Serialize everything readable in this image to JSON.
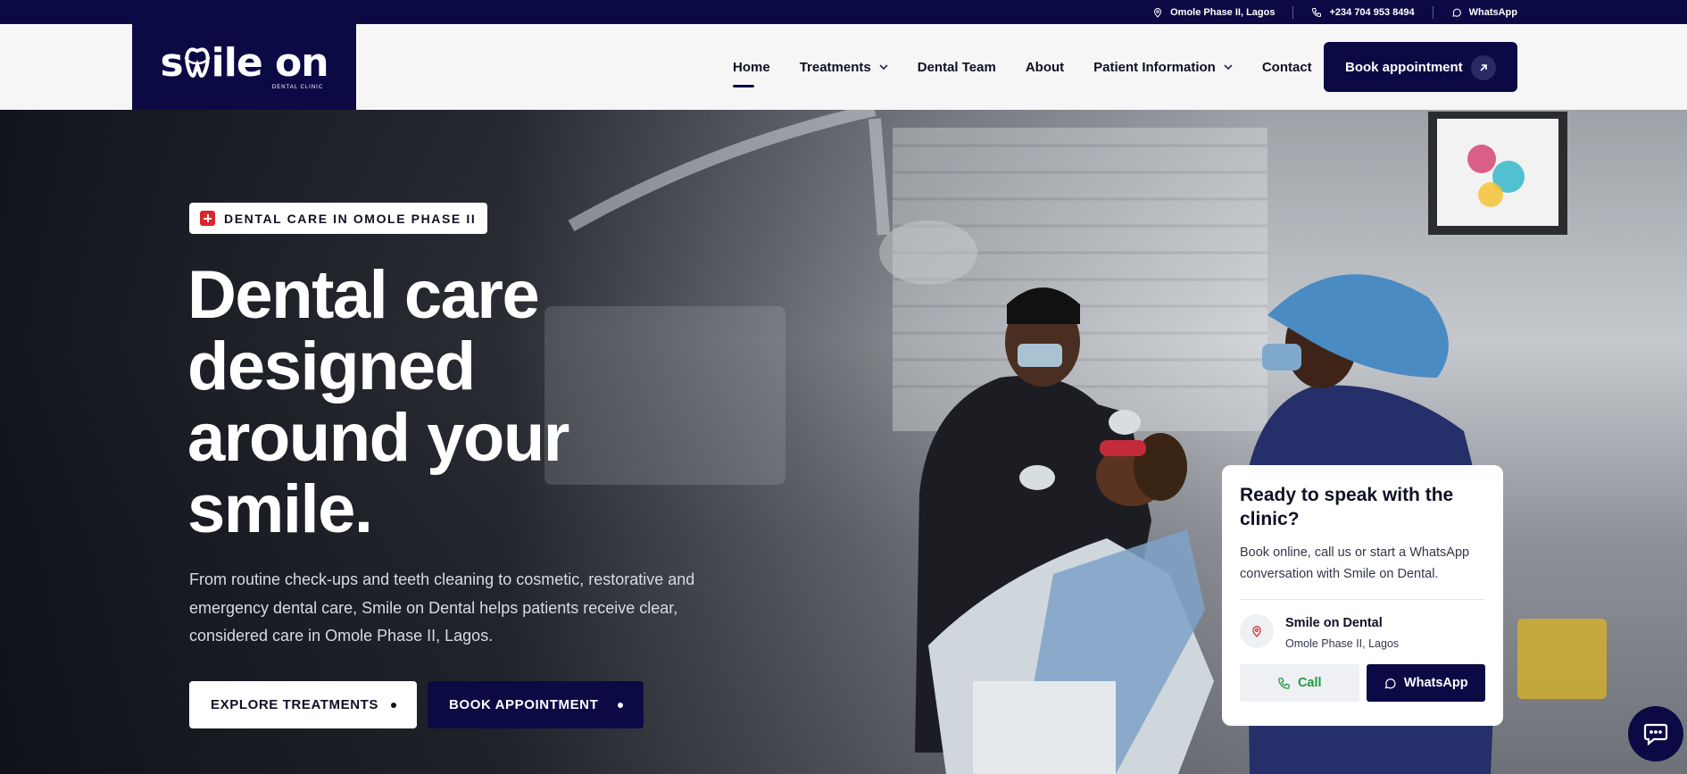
{
  "topbar": {
    "location": "Omole Phase II, Lagos",
    "phone": "+234 704 953 8494",
    "whatsapp": "WhatsApp"
  },
  "logo": {
    "word_start": "s",
    "word_end": "ile on",
    "subtitle": "DENTAL CLINIC"
  },
  "nav": {
    "items": [
      {
        "label": "Home",
        "active": true
      },
      {
        "label": "Treatments",
        "dropdown": true
      },
      {
        "label": "Dental Team"
      },
      {
        "label": "About"
      },
      {
        "label": "Patient Information",
        "dropdown": true
      },
      {
        "label": "Contact"
      }
    ],
    "book_label": "Book appointment"
  },
  "hero": {
    "badge": "DENTAL CARE IN OMOLE PHASE II",
    "headline": [
      "Dental care",
      "designed",
      "around your",
      "smile."
    ],
    "lede": "From routine check-ups and teeth cleaning to cosmetic, restorative and emergency dental care, Smile on Dental helps patients receive clear, considered care in Omole Phase II, Lagos.",
    "cta_primary": "EXPLORE TREATMENTS",
    "cta_secondary": "BOOK APPOINTMENT"
  },
  "card": {
    "title": "Ready to speak with the clinic?",
    "text": "Book online, call us or start a WhatsApp conversation with Smile on Dental.",
    "location_name": "Smile on Dental",
    "location_address": "Omole Phase II, Lagos",
    "call_label": "Call",
    "whatsapp_label": "WhatsApp"
  },
  "colors": {
    "brand_navy": "#0c0a45",
    "accent_red": "#d9262c",
    "call_green": "#1e9a3d"
  }
}
